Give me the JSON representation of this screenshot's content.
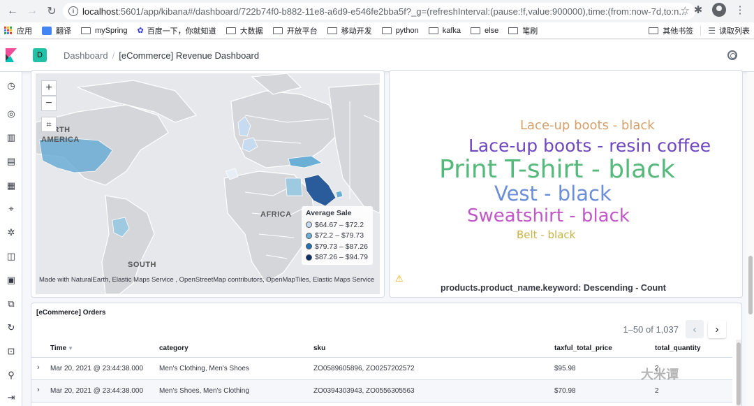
{
  "browser": {
    "url_host": "localhost",
    "url_rest": ":5601/app/kibana#/dashboard/722b74f0-b882-11e8-a6d9-e546fe2bba5f?_g=(refreshInterval:(pause:!f,value:900000),time:(from:now-7d,to:n...",
    "bookmarks": [
      "应用",
      "翻译",
      "mySpring",
      "百度一下，你就知道",
      "大数据",
      "开放平台",
      "移动开发",
      "python",
      "kafka",
      "else",
      "笔刷"
    ],
    "bookmarks_right": [
      "其他书签",
      "读取列表"
    ]
  },
  "header": {
    "space_initial": "D",
    "breadcrumb_root": "Dashboard",
    "breadcrumb_current": "[eCommerce] Revenue Dashboard"
  },
  "map": {
    "zoom_in": "+",
    "zoom_out": "−",
    "labels": [
      "NORTH AMERICA",
      "AFRICA",
      "SOUTH"
    ],
    "legend_title": "Average Sale",
    "legend": [
      {
        "label": "$64.67 – $72.2",
        "color": "#c6dbef"
      },
      {
        "label": "$72.2 – $79.73",
        "color": "#6baed6"
      },
      {
        "label": "$79.73 – $87.26",
        "color": "#2171b5"
      },
      {
        "label": "$87.26 – $94.79",
        "color": "#08306b"
      }
    ],
    "attribution": "Made with NaturalEarth, Elastic Maps Service , OpenStreetMap contributors, OpenMapTiles, Elastic Maps Service"
  },
  "cloud": {
    "words": [
      {
        "text": "Lace-up boots - black",
        "color": "#d6a06a"
      },
      {
        "text": "Lace-up boots - resin coffee",
        "color": "#6f47c1"
      },
      {
        "text": "Print T-shirt - black",
        "color": "#54b97a"
      },
      {
        "text": "Vest - black",
        "color": "#6c8ed9"
      },
      {
        "text": "Sweatshirt - black",
        "color": "#c157c7"
      },
      {
        "text": "Belt - black",
        "color": "#c8b340"
      }
    ],
    "title": "products.product_name.keyword: Descending - Count"
  },
  "orders": {
    "title": "[eCommerce] Orders",
    "pager": "1–50 of 1,037",
    "columns": [
      "Time",
      "category",
      "sku",
      "taxful_total_price",
      "total_quantity"
    ],
    "rows": [
      {
        "time": "Mar 20, 2021 @ 23:44:38.000",
        "category": "Men's Clothing, Men's Shoes",
        "sku": "ZO0589605896, ZO0257202572",
        "price": "$95.98",
        "qty": "2"
      },
      {
        "time": "Mar 20, 2021 @ 23:44:38.000",
        "category": "Men's Shoes, Men's Clothing",
        "sku": "ZO0394303943, ZO0556305563",
        "price": "$70.98",
        "qty": "2"
      }
    ]
  },
  "watermark": "大米谭"
}
